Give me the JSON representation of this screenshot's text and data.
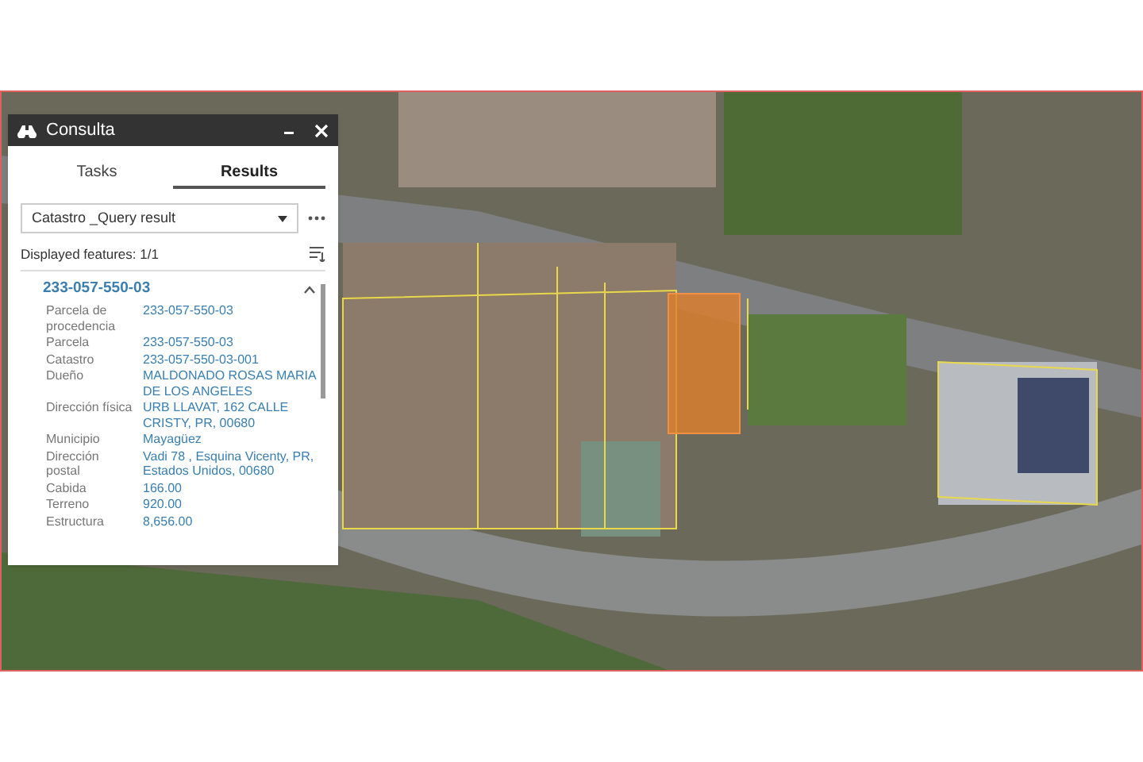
{
  "window": {
    "title": "Consulta"
  },
  "tabs": [
    {
      "label": "Tasks",
      "selected": false
    },
    {
      "label": "Results",
      "selected": true
    }
  ],
  "layer_select": {
    "value": "Catastro _Query result"
  },
  "displayed_features": "Displayed features: 1/1",
  "result": {
    "title": "233-057-550-03",
    "expanded": true,
    "fields": [
      {
        "label": "Parcela de procedencia",
        "value": "233-057-550-03"
      },
      {
        "label": "Parcela",
        "value": "233-057-550-03"
      },
      {
        "label": "Catastro",
        "value": "233-057-550-03-001"
      },
      {
        "label": "Dueño",
        "value": "MALDONADO ROSAS MARIA DE LOS ANGELES"
      },
      {
        "label": "Dirección física",
        "value": "URB LLAVAT, 162 CALLE CRISTY, PR, 00680"
      },
      {
        "label": "Municipio",
        "value": "Mayagüez"
      },
      {
        "label": "Dirección postal",
        "value": "Vadi 78 , Esquina Vicenty, PR, Estados Unidos, 00680"
      },
      {
        "label": "Cabida",
        "value": "166.00"
      },
      {
        "label": "Terreno",
        "value": "920.00"
      },
      {
        "label": "Estructura",
        "value": "8,656.00"
      }
    ]
  }
}
